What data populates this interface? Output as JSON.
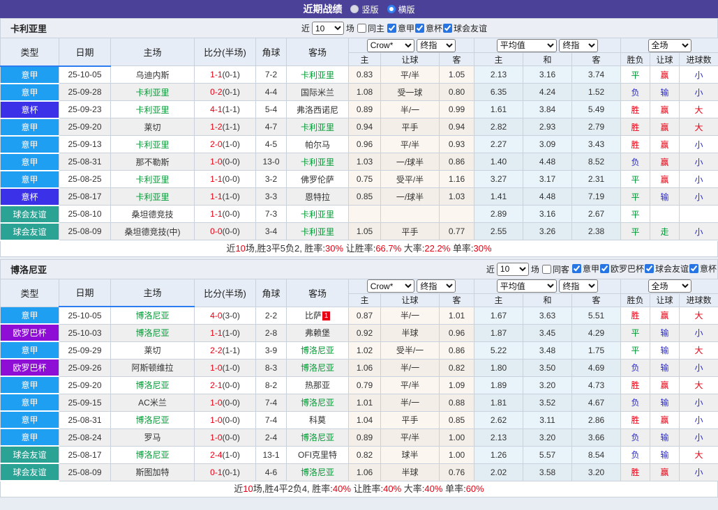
{
  "title_bar": {
    "title": "近期战绩",
    "options": [
      {
        "label": "竖版",
        "selected": false
      },
      {
        "label": "横版",
        "selected": true
      }
    ]
  },
  "colors": {
    "type_badges": {
      "意甲": "#1e9ff2",
      "意杯": "#3b31e8",
      "球会友谊": "#2aa294",
      "欧罗巴杯": "#8e0ed6"
    },
    "result": {
      "胜": "#e60012",
      "平": "#009933",
      "负": "#2828cc",
      "赢": "#e60012",
      "输": "#2828cc",
      "走": "#009933",
      "大": "#e60012",
      "小": "#2828cc"
    },
    "team_highlight": "#009933",
    "score_fulltime": "#e60012",
    "red_card": "#e60012",
    "accent_purple": "#4b4199"
  },
  "table_header": {
    "cols": [
      "类型",
      "日期",
      "主场",
      "比分(半场)",
      "角球",
      "客场"
    ],
    "odds_group": {
      "selects": [
        "Crow*",
        "终指"
      ],
      "cols": [
        "主",
        "让球",
        "客"
      ]
    },
    "avg_group": {
      "selects": [
        "平均值",
        "终指"
      ],
      "cols": [
        "主",
        "和",
        "客"
      ]
    },
    "result_group": {
      "selects": [
        "全场"
      ],
      "cols": [
        "胜负",
        "让球",
        "进球数"
      ]
    }
  },
  "sections": [
    {
      "team": "卡利亚里",
      "filter": {
        "near_label": "近",
        "count": "10",
        "games_label": "场",
        "same_label": "同主",
        "same_checked": false,
        "competitions": [
          {
            "label": "意甲",
            "checked": true
          },
          {
            "label": "意杯",
            "checked": true
          },
          {
            "label": "球会友谊",
            "checked": true
          }
        ]
      },
      "rows": [
        {
          "type": "意甲",
          "date": "25-10-05",
          "home": "乌迪内斯",
          "score_ft": "1-1",
          "score_ht": "(0-1)",
          "corner": "7-2",
          "away": "卡利亚里",
          "away_hl": true,
          "odds": [
            "0.83",
            "平/半",
            "1.05"
          ],
          "avg": [
            "2.13",
            "3.16",
            "3.74"
          ],
          "res": [
            "平",
            "赢",
            "小"
          ]
        },
        {
          "type": "意甲",
          "date": "25-09-28",
          "home": "卡利亚里",
          "home_hl": true,
          "score_ft": "0-2",
          "score_ht": "(0-1)",
          "corner": "4-4",
          "away": "国际米兰",
          "odds": [
            "1.08",
            "受一球",
            "0.80"
          ],
          "avg": [
            "6.35",
            "4.24",
            "1.52"
          ],
          "res": [
            "负",
            "输",
            "小"
          ]
        },
        {
          "type": "意杯",
          "date": "25-09-23",
          "home": "卡利亚里",
          "home_hl": true,
          "score_ft": "4-1",
          "score_ht": "(1-1)",
          "corner": "5-4",
          "away": "弗洛西诺尼",
          "odds": [
            "0.89",
            "半/一",
            "0.99"
          ],
          "avg": [
            "1.61",
            "3.84",
            "5.49"
          ],
          "res": [
            "胜",
            "赢",
            "大"
          ]
        },
        {
          "type": "意甲",
          "date": "25-09-20",
          "home": "莱切",
          "score_ft": "1-2",
          "score_ht": "(1-1)",
          "corner": "4-7",
          "away": "卡利亚里",
          "away_hl": true,
          "odds": [
            "0.94",
            "平手",
            "0.94"
          ],
          "avg": [
            "2.82",
            "2.93",
            "2.79"
          ],
          "res": [
            "胜",
            "赢",
            "大"
          ]
        },
        {
          "type": "意甲",
          "date": "25-09-13",
          "home": "卡利亚里",
          "home_hl": true,
          "score_ft": "2-0",
          "score_ht": "(1-0)",
          "corner": "4-5",
          "away": "帕尔马",
          "odds": [
            "0.96",
            "平/半",
            "0.93"
          ],
          "avg": [
            "2.27",
            "3.09",
            "3.43"
          ],
          "res": [
            "胜",
            "赢",
            "小"
          ]
        },
        {
          "type": "意甲",
          "date": "25-08-31",
          "home": "那不勒斯",
          "score_ft": "1-0",
          "score_ht": "(0-0)",
          "corner": "13-0",
          "away": "卡利亚里",
          "away_hl": true,
          "odds": [
            "1.03",
            "一/球半",
            "0.86"
          ],
          "avg": [
            "1.40",
            "4.48",
            "8.52"
          ],
          "res": [
            "负",
            "赢",
            "小"
          ]
        },
        {
          "type": "意甲",
          "date": "25-08-25",
          "home": "卡利亚里",
          "home_hl": true,
          "score_ft": "1-1",
          "score_ht": "(0-0)",
          "corner": "3-2",
          "away": "佛罗伦萨",
          "odds": [
            "0.75",
            "受平/半",
            "1.16"
          ],
          "avg": [
            "3.27",
            "3.17",
            "2.31"
          ],
          "res": [
            "平",
            "赢",
            "小"
          ]
        },
        {
          "type": "意杯",
          "date": "25-08-17",
          "home": "卡利亚里",
          "home_hl": true,
          "score_ft": "1-1",
          "score_ht": "(1-0)",
          "corner": "3-3",
          "away": "恩特拉",
          "odds": [
            "0.85",
            "一/球半",
            "1.03"
          ],
          "avg": [
            "1.41",
            "4.48",
            "7.19"
          ],
          "res": [
            "平",
            "输",
            "小"
          ]
        },
        {
          "type": "球会友谊",
          "date": "25-08-10",
          "home": "桑坦德竞技",
          "score_ft": "1-1",
          "score_ht": "(0-0)",
          "corner": "7-3",
          "away": "卡利亚里",
          "away_hl": true,
          "odds": [
            "",
            "",
            ""
          ],
          "avg": [
            "2.89",
            "3.16",
            "2.67"
          ],
          "res": [
            "平",
            "",
            ""
          ]
        },
        {
          "type": "球会友谊",
          "date": "25-08-09",
          "home": "桑坦德竞技(中)",
          "score_ft": "0-0",
          "score_ht": "(0-0)",
          "corner": "3-4",
          "away": "卡利亚里",
          "away_hl": true,
          "odds": [
            "1.05",
            "平手",
            "0.77"
          ],
          "avg": [
            "2.55",
            "3.26",
            "2.38"
          ],
          "res": [
            "平",
            "走",
            "小"
          ]
        }
      ],
      "summary": [
        {
          "text": "近",
          "red": false
        },
        {
          "text": "10",
          "red": true
        },
        {
          "text": "场,胜3平5负2, 胜率:",
          "red": false
        },
        {
          "text": "30%",
          "red": true
        },
        {
          "text": " 让胜率:",
          "red": false
        },
        {
          "text": "66.7%",
          "red": true
        },
        {
          "text": " 大率:",
          "red": false
        },
        {
          "text": "22.2%",
          "red": true
        },
        {
          "text": " 单率:",
          "red": false
        },
        {
          "text": "30%",
          "red": true
        }
      ]
    },
    {
      "team": "博洛尼亚",
      "filter": {
        "near_label": "近",
        "count": "10",
        "games_label": "场",
        "same_label": "同客",
        "same_checked": false,
        "competitions": [
          {
            "label": "意甲",
            "checked": true
          },
          {
            "label": "欧罗巴杯",
            "checked": true
          },
          {
            "label": "球会友谊",
            "checked": true
          },
          {
            "label": "意杯",
            "checked": true
          }
        ]
      },
      "rows": [
        {
          "type": "意甲",
          "date": "25-10-05",
          "home": "博洛尼亚",
          "home_hl": true,
          "score_ft": "4-0",
          "score_ht": "(3-0)",
          "corner": "2-2",
          "away": "比萨",
          "away_card": "1",
          "odds": [
            "0.87",
            "半/一",
            "1.01"
          ],
          "avg": [
            "1.67",
            "3.63",
            "5.51"
          ],
          "res": [
            "胜",
            "赢",
            "大"
          ]
        },
        {
          "type": "欧罗巴杯",
          "date": "25-10-03",
          "home": "博洛尼亚",
          "home_hl": true,
          "score_ft": "1-1",
          "score_ht": "(1-0)",
          "corner": "2-8",
          "away": "弗赖堡",
          "odds": [
            "0.92",
            "半球",
            "0.96"
          ],
          "avg": [
            "1.87",
            "3.45",
            "4.29"
          ],
          "res": [
            "平",
            "输",
            "小"
          ]
        },
        {
          "type": "意甲",
          "date": "25-09-29",
          "home": "莱切",
          "score_ft": "2-2",
          "score_ht": "(1-1)",
          "corner": "3-9",
          "away": "博洛尼亚",
          "away_hl": true,
          "odds": [
            "1.02",
            "受半/一",
            "0.86"
          ],
          "avg": [
            "5.22",
            "3.48",
            "1.75"
          ],
          "res": [
            "平",
            "输",
            "大"
          ]
        },
        {
          "type": "欧罗巴杯",
          "date": "25-09-26",
          "home": "阿斯顿维拉",
          "score_ft": "1-0",
          "score_ht": "(1-0)",
          "corner": "8-3",
          "away": "博洛尼亚",
          "away_hl": true,
          "odds": [
            "1.06",
            "半/一",
            "0.82"
          ],
          "avg": [
            "1.80",
            "3.50",
            "4.69"
          ],
          "res": [
            "负",
            "输",
            "小"
          ]
        },
        {
          "type": "意甲",
          "date": "25-09-20",
          "home": "博洛尼亚",
          "home_hl": true,
          "score_ft": "2-1",
          "score_ht": "(0-0)",
          "corner": "8-2",
          "away": "热那亚",
          "odds": [
            "0.79",
            "平/半",
            "1.09"
          ],
          "avg": [
            "1.89",
            "3.20",
            "4.73"
          ],
          "res": [
            "胜",
            "赢",
            "大"
          ]
        },
        {
          "type": "意甲",
          "date": "25-09-15",
          "home": "AC米兰",
          "score_ft": "1-0",
          "score_ht": "(0-0)",
          "corner": "7-4",
          "away": "博洛尼亚",
          "away_hl": true,
          "odds": [
            "1.01",
            "半/一",
            "0.88"
          ],
          "avg": [
            "1.81",
            "3.52",
            "4.67"
          ],
          "res": [
            "负",
            "输",
            "小"
          ]
        },
        {
          "type": "意甲",
          "date": "25-08-31",
          "home": "博洛尼亚",
          "home_hl": true,
          "score_ft": "1-0",
          "score_ht": "(0-0)",
          "corner": "7-4",
          "away": "科莫",
          "odds": [
            "1.04",
            "平手",
            "0.85"
          ],
          "avg": [
            "2.62",
            "3.11",
            "2.86"
          ],
          "res": [
            "胜",
            "赢",
            "小"
          ]
        },
        {
          "type": "意甲",
          "date": "25-08-24",
          "home": "罗马",
          "score_ft": "1-0",
          "score_ht": "(0-0)",
          "corner": "2-4",
          "away": "博洛尼亚",
          "away_hl": true,
          "odds": [
            "0.89",
            "平/半",
            "1.00"
          ],
          "avg": [
            "2.13",
            "3.20",
            "3.66"
          ],
          "res": [
            "负",
            "输",
            "小"
          ]
        },
        {
          "type": "球会友谊",
          "date": "25-08-17",
          "home": "博洛尼亚",
          "home_hl": true,
          "score_ft": "2-4",
          "score_ht": "(1-0)",
          "corner": "13-1",
          "away": "OFI克里特",
          "odds": [
            "0.82",
            "球半",
            "1.00"
          ],
          "avg": [
            "1.26",
            "5.57",
            "8.54"
          ],
          "res": [
            "负",
            "输",
            "大"
          ]
        },
        {
          "type": "球会友谊",
          "date": "25-08-09",
          "home": "斯图加特",
          "score_ft": "0-1",
          "score_ht": "(0-1)",
          "corner": "4-6",
          "away": "博洛尼亚",
          "away_hl": true,
          "odds": [
            "1.06",
            "半球",
            "0.76"
          ],
          "avg": [
            "2.02",
            "3.58",
            "3.20"
          ],
          "res": [
            "胜",
            "赢",
            "小"
          ]
        }
      ],
      "summary": [
        {
          "text": "近",
          "red": false
        },
        {
          "text": "10",
          "red": true
        },
        {
          "text": "场,胜4平2负4, 胜率:",
          "red": false
        },
        {
          "text": "40%",
          "red": true
        },
        {
          "text": " 让胜率:",
          "red": false
        },
        {
          "text": "40%",
          "red": true
        },
        {
          "text": " 大率:",
          "red": false
        },
        {
          "text": "40%",
          "red": true
        },
        {
          "text": " 单率:",
          "red": false
        },
        {
          "text": "60%",
          "red": true
        }
      ]
    }
  ]
}
